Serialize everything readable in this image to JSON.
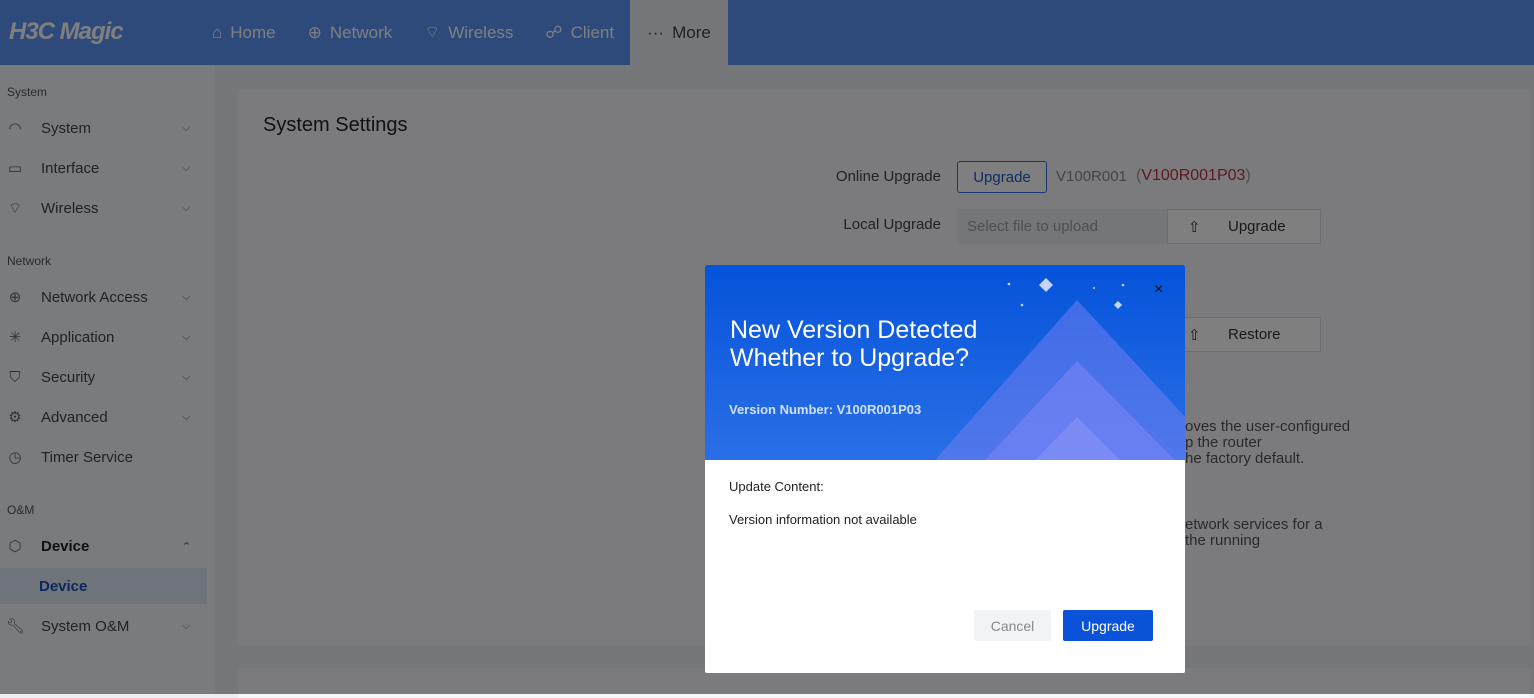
{
  "header": {
    "logo": "H3C Magic",
    "nav": [
      {
        "label": "Home",
        "icon": "home-icon"
      },
      {
        "label": "Network",
        "icon": "globe-icon"
      },
      {
        "label": "Wireless",
        "icon": "wifi-icon"
      },
      {
        "label": "Client",
        "icon": "client-icon"
      },
      {
        "label": "More",
        "icon": "more-icon"
      }
    ],
    "brand_color": "#5b95f6"
  },
  "sidebar": {
    "sections": [
      "System",
      "Network",
      "O&M"
    ],
    "items": [
      {
        "label": "System"
      },
      {
        "label": "Interface"
      },
      {
        "label": "Wireless"
      },
      {
        "label": "Network Access"
      },
      {
        "label": "Application"
      },
      {
        "label": "Security"
      },
      {
        "label": "Advanced"
      },
      {
        "label": "Timer Service"
      },
      {
        "label": "Device"
      },
      {
        "label": "Device"
      },
      {
        "label": "System O&M"
      }
    ]
  },
  "main": {
    "title": "System Settings",
    "online_upgrade": {
      "label": "Online Upgrade",
      "button": "Upgrade",
      "current_version": "V100R001",
      "new_version": "V100R001P03",
      "open_paren": "(",
      "close_paren": ")"
    },
    "local_upgrade": {
      "label": "Local Upgrade",
      "placeholder": "Select file to upload",
      "button": "Upgrade"
    },
    "restore": {
      "button": "Restore"
    },
    "desc1": [
      "oves the user-configured",
      "p the router",
      "he factory default."
    ],
    "desc2": [
      "etwork services for a",
      "the running"
    ]
  },
  "modal": {
    "title_line1": "New Version Detected",
    "title_line2": "Whether to Upgrade?",
    "version": "Version Number: V100R001P03",
    "close": "×",
    "update_label": "Update Content:",
    "update_text": "Version information not available",
    "cancel": "Cancel",
    "upgrade": "Upgrade",
    "accent": "#0a52d8"
  }
}
